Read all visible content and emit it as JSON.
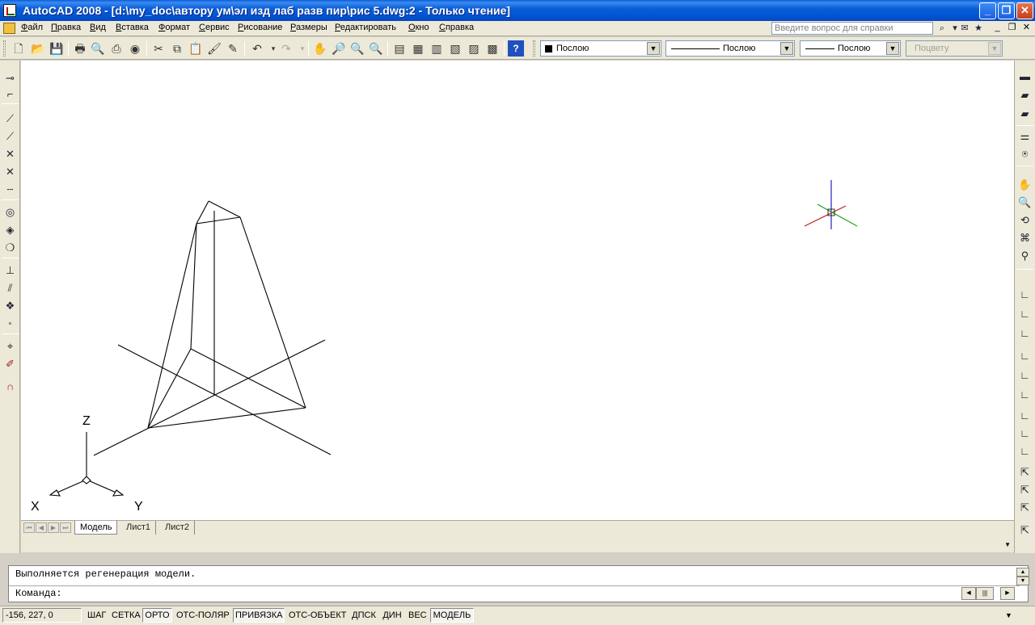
{
  "window": {
    "title": "AutoCAD 2008 - [d:\\my_doc\\автору ум\\эл изд лаб разв пир\\рис 5.dwg:2 - Только чтение]",
    "minimize": "_",
    "restore": "❐",
    "close": "✕"
  },
  "menu": {
    "items": [
      "Файл",
      "Правка",
      "Вид",
      "Вставка",
      "Формат",
      "Сервис",
      "Рисование",
      "Размеры",
      "Редактировать",
      "Окно",
      "Справка"
    ],
    "help_placeholder": "Введите вопрос для справки"
  },
  "properties": {
    "color": "Послою",
    "linetype": "Послою",
    "lineweight": "Послою",
    "plotstyle": "Поцвету"
  },
  "drawing": {
    "ucs_axes": {
      "z": "Z",
      "x": "X",
      "y": "Y"
    }
  },
  "tabs": {
    "items": [
      {
        "label": "Модель",
        "active": true
      },
      {
        "label": "Лист1",
        "active": false
      },
      {
        "label": "Лист2",
        "active": false
      }
    ]
  },
  "command": {
    "history": "Выполняется регенерация модели.",
    "prompt": "Команда:"
  },
  "status": {
    "coordinates": "-156, 227, 0",
    "buttons": [
      {
        "label": "ШАГ",
        "on": false
      },
      {
        "label": "СЕТКА",
        "on": false
      },
      {
        "label": "ОРТО",
        "on": true
      },
      {
        "label": "ОТС-ПОЛЯР",
        "on": false
      },
      {
        "label": "ПРИВЯЗКА",
        "on": true
      },
      {
        "label": "ОТС-ОБЪЕКТ",
        "on": false
      },
      {
        "label": "ДПСК",
        "on": false
      },
      {
        "label": "ДИН",
        "on": false
      },
      {
        "label": "ВЕС",
        "on": false
      },
      {
        "label": "МОДЕЛЬ",
        "on": true
      }
    ]
  },
  "colors": {
    "title_bar": "#0a5fd8",
    "canvas": "#ffffff",
    "chrome": "#ece9d8",
    "crosshair_z": "#2020c0",
    "crosshair_x": "#c02020",
    "crosshair_y": "#20a020"
  }
}
